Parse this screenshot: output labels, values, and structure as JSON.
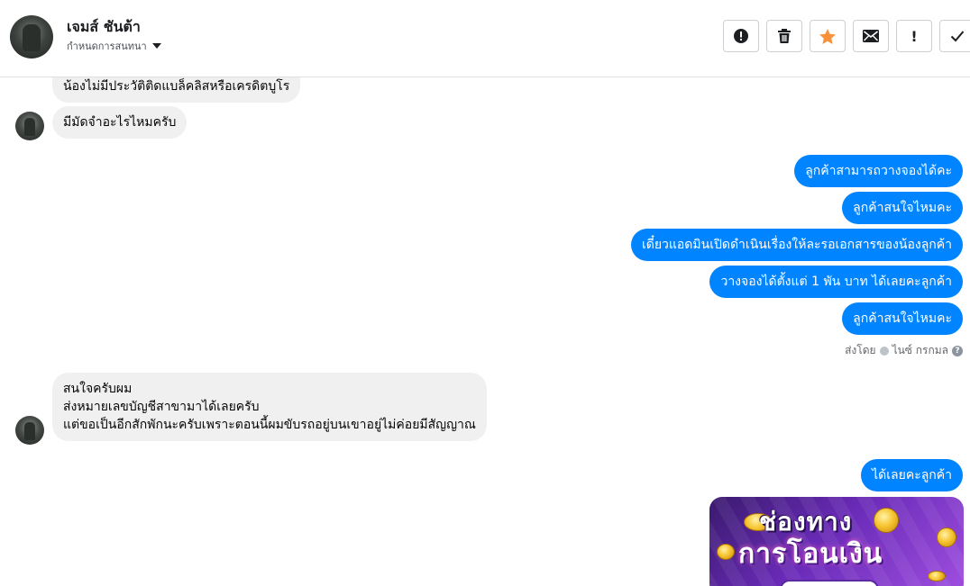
{
  "header": {
    "contact_name": "เจมส์ ชันต้า",
    "subtitle": "กำหนดการสนทนา",
    "tools": [
      {
        "name": "spam-button",
        "icon": "alert-circle-icon"
      },
      {
        "name": "delete-button",
        "icon": "trash-icon"
      },
      {
        "name": "star-button",
        "icon": "star-icon",
        "color": "#f7923a"
      },
      {
        "name": "mark-unread-button",
        "icon": "envelope-icon"
      },
      {
        "name": "follow-up-button",
        "icon": "exclamation-icon",
        "glyph": "!"
      },
      {
        "name": "done-button",
        "icon": "check-icon"
      }
    ]
  },
  "messages": [
    {
      "from": "contact",
      "text": "น้องไม่มีประวัติติดแบล็คลิสหรือเครดิตบูโร"
    },
    {
      "from": "contact",
      "text": "มีมัดจำอะไรไหมครับ"
    },
    {
      "from": "page",
      "text": "ลูกค้าสามารถวางจองได้คะ"
    },
    {
      "from": "page",
      "text": "ลูกค้าสนใจไหมคะ"
    },
    {
      "from": "page",
      "text": "เดี๋ยวแอดมินเปิดดำเนินเรื่องให้ละรอเอกสารของน้องลูกค้า"
    },
    {
      "from": "page",
      "text": "วางจองได้ตั้งแต่ 1 พัน บาท ได้เลยคะลูกค้า"
    },
    {
      "from": "page",
      "text": "ลูกค้าสนใจไหมคะ"
    },
    {
      "from": "contact",
      "lines": [
        "สนใจครับผม",
        "ส่งหมายเลขบัญชีสาขามาได้เลยครับ",
        "แต่ขอเป็นอีกสักพักนะครับเพราะตอนนี้ผมขับรถอยู่บนเขาอยู่ไม่ค่อยมีสัญญาณ"
      ]
    },
    {
      "from": "page",
      "text": "ได้เลยคะลูกค้า"
    }
  ],
  "sent_by": {
    "prefix": "ส่งโดย",
    "agent": "ไนซ์ กรกมล",
    "help_glyph": "?"
  },
  "promo_image": {
    "line1": "ช่องทาง",
    "line2": "การโอนเงิน"
  },
  "colors": {
    "outgoing": "#0084ff",
    "incoming": "#f0f0f0",
    "star": "#f7923a"
  }
}
